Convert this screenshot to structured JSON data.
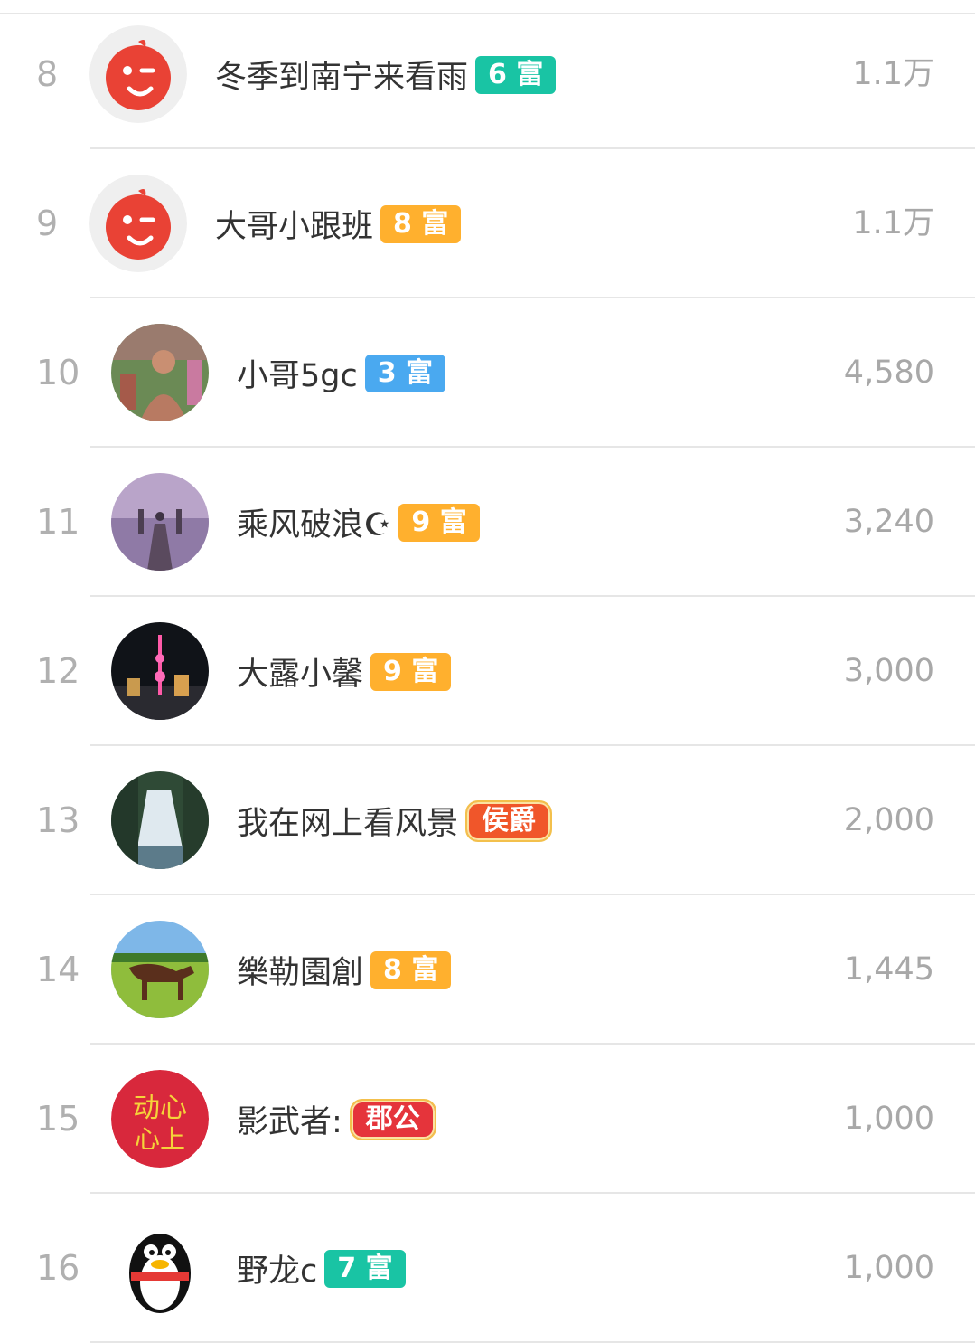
{
  "rows": [
    {
      "rank": "8",
      "name": "冬季到南宁来看雨",
      "badge": "6 富",
      "badge_color": "#19c4a4",
      "value": "1.1万",
      "avatar": "default-sprite"
    },
    {
      "rank": "9",
      "name": "大哥小跟班",
      "badge": "8 富",
      "badge_color": "#ffb02e",
      "value": "1.1万",
      "avatar": "default-sprite"
    },
    {
      "rank": "10",
      "name": "小哥5gc",
      "badge": "3 富",
      "badge_color": "#4aa9f0",
      "value": "4,580",
      "avatar": "photo-person"
    },
    {
      "rank": "11",
      "name": "乘风破浪☪",
      "badge": "9 富",
      "badge_color": "#ffb02e",
      "value": "3,240",
      "avatar": "photo-pier"
    },
    {
      "rank": "12",
      "name": "大露小馨",
      "badge": "9 富",
      "badge_color": "#ffb02e",
      "value": "3,000",
      "avatar": "photo-city-night"
    },
    {
      "rank": "13",
      "name": "我在网上看风景",
      "badge": "侯爵",
      "badge_color": "#f0562a",
      "value": "2,000",
      "avatar": "photo-waterfall"
    },
    {
      "rank": "14",
      "name": "樂勒園創",
      "badge": "8 富",
      "badge_color": "#ffb02e",
      "value": "1,445",
      "avatar": "photo-horse"
    },
    {
      "rank": "15",
      "name": "影武者:",
      "badge": "郡公",
      "badge_color": "#e5343b",
      "value": "1,000",
      "avatar": "calligraphy-red"
    },
    {
      "rank": "16",
      "name": "野龙c",
      "badge": "7 富",
      "badge_color": "#19c4a4",
      "value": "1,000",
      "avatar": "penguin"
    }
  ]
}
